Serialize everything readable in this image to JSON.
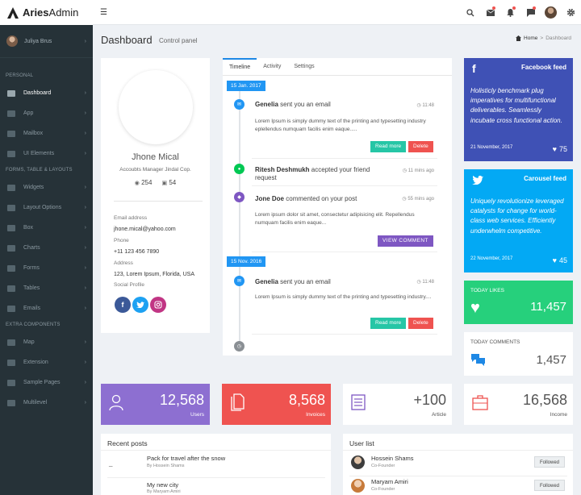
{
  "app": {
    "brand_bold": "Aries",
    "brand_light": "Admin"
  },
  "topbar": {
    "icons": [
      "search-icon",
      "mail-icon",
      "bell-icon",
      "chat-icon",
      "avatar",
      "gear-icon"
    ]
  },
  "sidebar": {
    "user": "Juliya Brus",
    "sections": {
      "personal": "PERSONAL",
      "forms": "FORMS, TABLE & LAYOUTS",
      "extra": "EXTRA COMPONENTS"
    },
    "personal_items": [
      {
        "label": "Dashboard",
        "active": true
      },
      {
        "label": "App"
      },
      {
        "label": "Mailbox"
      },
      {
        "label": "UI Elements"
      }
    ],
    "forms_items": [
      {
        "label": "Widgets"
      },
      {
        "label": "Layout Options"
      },
      {
        "label": "Box"
      },
      {
        "label": "Charts"
      },
      {
        "label": "Forms"
      },
      {
        "label": "Tables"
      },
      {
        "label": "Emails"
      }
    ],
    "extra_items": [
      {
        "label": "Map"
      },
      {
        "label": "Extension"
      },
      {
        "label": "Sample Pages"
      },
      {
        "label": "Multilevel"
      }
    ]
  },
  "header": {
    "title": "Dashboard",
    "subtitle": "Control panel",
    "crumb_home": "Home",
    "crumb_sep": ">",
    "crumb_current": "Dashboard"
  },
  "profile": {
    "name": "Jhone Mical",
    "job": "Accoubts Manager Jindal Cop.",
    "views": "254",
    "photos": "54",
    "email_label": "Email address",
    "email": "jhone.mical@yahoo.com",
    "phone_label": "Phone",
    "phone": "+11 123 456 7890",
    "address_label": "Address",
    "address": "123, Lorem Ipsum, Florida, USA",
    "social_label": "Social Profile"
  },
  "timeline": {
    "tabs": [
      "Timeline",
      "Activity",
      "Settings"
    ],
    "date1": "15 Jan. 2017",
    "date2": "15 Nov. 2016",
    "items": [
      {
        "name": "Genelia",
        "action": " sent you an email",
        "time": "11:48",
        "body": "Lorem Ipsum is simply dummy text of the printing and typesetting industry eplellendus numquam facilis enim eaque....."
      },
      {
        "name": "Ritesh Deshmukh",
        "action": " accepted your friend request",
        "time": "11 mins ago"
      },
      {
        "name": "Jone Doe",
        "action": " commented on your post",
        "time": "55 mins ago",
        "body": "Lorem ipsum dolor sit amet, consectetur adipisicing elit. Repellendus numquam facilis enim eaque..."
      },
      {
        "name": "Genelia",
        "action": " sent you an email",
        "time": "11:48",
        "body": "Lorem Ipsum is simply dummy text of the printing and typesetting industry...."
      }
    ],
    "read_more": "Read more",
    "delete": "Delete",
    "view_comment": "VIEW COMMENT"
  },
  "facebook": {
    "title": "Facebook feed",
    "text": "Holisticly benchmark plug imperatives for multifunctional deliverables. Seamlessly incubate cross functional action.",
    "date": "21 November, 2017",
    "likes": "75",
    "color": "#3f51b5"
  },
  "twitter": {
    "title": "Carousel feed",
    "text": "Uniquely revolutionize leveraged catalysts for change for world-class web services. Efficiently underwhelm competitive.",
    "date": "22 November, 2017",
    "likes": "45",
    "color": "#03a9f4"
  },
  "today_likes": {
    "label": "TODAY LIKES",
    "value": "11,457",
    "color": "#26d07c"
  },
  "today_comments": {
    "label": "TODAY COMMENTS",
    "value": "1,457"
  },
  "stats": [
    {
      "value": "12,568",
      "label": "Users",
      "color": "#8d6fd1"
    },
    {
      "value": "8,568",
      "label": "Invoices",
      "color": "#ef5350"
    },
    {
      "value": "+100",
      "label": "Article"
    },
    {
      "value": "16,568",
      "label": "Income"
    }
  ],
  "recent_posts": {
    "title": "Recent posts",
    "items": [
      {
        "thumb": "_",
        "title": "Pack for travel after the snow",
        "author": "By Hossein Shams"
      },
      {
        "thumb": "",
        "title": "My new city",
        "author": "By Maryam Amiri"
      }
    ]
  },
  "user_list": {
    "title": "User list",
    "items": [
      {
        "name": "Hossein Shams",
        "role": "Co-Founder",
        "button": "Followed"
      },
      {
        "name": "Maryam Amiri",
        "role": "Co-Founder",
        "button": "Followed"
      }
    ]
  }
}
